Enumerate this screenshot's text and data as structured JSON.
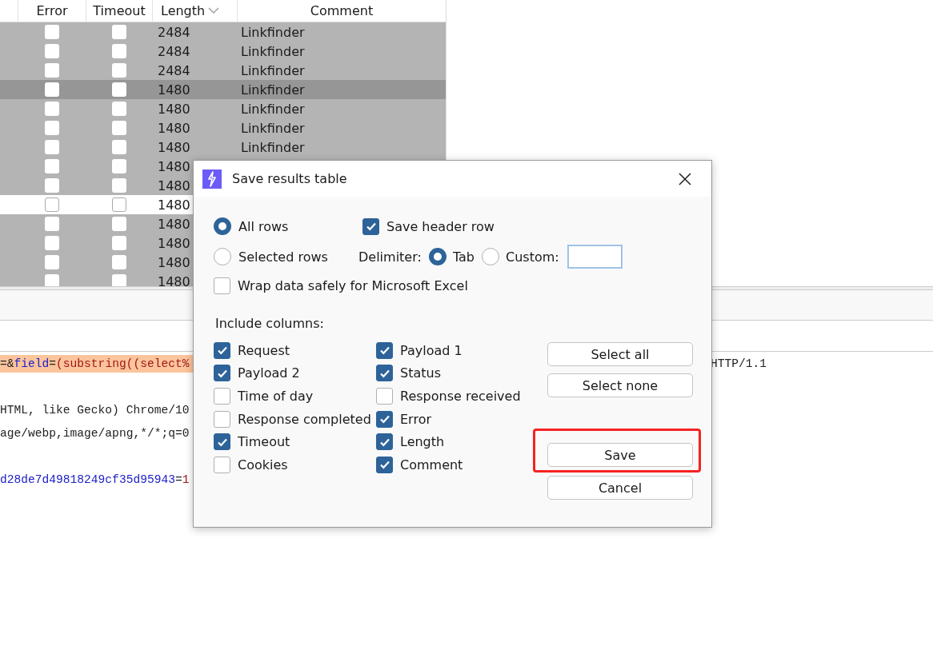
{
  "table": {
    "columns": [
      {
        "label": "Error",
        "sorted": false
      },
      {
        "label": "Timeout",
        "sorted": false
      },
      {
        "label": "Length",
        "sorted": true
      },
      {
        "label": "Comment",
        "sorted": false
      }
    ],
    "rows": [
      {
        "error": false,
        "timeout": false,
        "length": "2484",
        "comment": "Linkfinder",
        "selected": true,
        "focused": false
      },
      {
        "error": false,
        "timeout": false,
        "length": "2484",
        "comment": "Linkfinder",
        "selected": true,
        "focused": false
      },
      {
        "error": false,
        "timeout": false,
        "length": "2484",
        "comment": "Linkfinder",
        "selected": true,
        "focused": false
      },
      {
        "error": false,
        "timeout": false,
        "length": "1480",
        "comment": "Linkfinder",
        "selected": true,
        "focused": true
      },
      {
        "error": false,
        "timeout": false,
        "length": "1480",
        "comment": "Linkfinder",
        "selected": true,
        "focused": false
      },
      {
        "error": false,
        "timeout": false,
        "length": "1480",
        "comment": "Linkfinder",
        "selected": true,
        "focused": false
      },
      {
        "error": false,
        "timeout": false,
        "length": "1480",
        "comment": "Linkfinder",
        "selected": true,
        "focused": false
      },
      {
        "error": false,
        "timeout": false,
        "length": "1480",
        "selected": true,
        "focused": false
      },
      {
        "error": false,
        "timeout": false,
        "length": "1480",
        "selected": true,
        "focused": false
      },
      {
        "error": false,
        "timeout": false,
        "length": "1480",
        "selected": false,
        "focused": false
      },
      {
        "error": false,
        "timeout": false,
        "length": "1480",
        "selected": true,
        "focused": false
      },
      {
        "error": false,
        "timeout": false,
        "length": "1480",
        "selected": true,
        "focused": false
      },
      {
        "error": false,
        "timeout": false,
        "length": "1480",
        "selected": true,
        "focused": false
      },
      {
        "error": false,
        "timeout": false,
        "length": "1480",
        "selected": true,
        "focused": false
      }
    ]
  },
  "request_lines": [
    {
      "highlighted": true,
      "left": [
        {
          "kind": "plain",
          "text": "=&"
        },
        {
          "kind": "name",
          "text": "field"
        },
        {
          "kind": "plain",
          "text": "="
        },
        {
          "kind": "value",
          "text": "(substring((select%"
        }
      ],
      "right": [
        {
          "kind": "plain",
          "text": "HTTP/1.1"
        }
      ]
    },
    {
      "highlighted": false
    },
    {
      "highlighted": false,
      "left": [
        {
          "kind": "plain",
          "text": "HTML, like Gecko) Chrome/10"
        }
      ]
    },
    {
      "highlighted": false,
      "left": [
        {
          "kind": "plain",
          "text": "age/webp,image/apng,*/*;q=0"
        }
      ]
    },
    {
      "highlighted": false
    },
    {
      "highlighted": false,
      "left": [
        {
          "kind": "name",
          "text": "d28de7d49818249cf35d95943"
        },
        {
          "kind": "plain",
          "text": "="
        },
        {
          "kind": "value",
          "text": "1"
        }
      ]
    }
  ],
  "dialog": {
    "title": "Save results table",
    "row_scope": [
      {
        "label": "All rows",
        "selected": true
      },
      {
        "label": "Selected rows",
        "selected": false
      }
    ],
    "save_header_row": {
      "label": "Save header row",
      "checked": true
    },
    "delimiter": {
      "label": "Delimiter:",
      "options": [
        {
          "label": "Tab",
          "selected": true
        },
        {
          "label": "Custom:",
          "selected": false
        }
      ]
    },
    "wrap_excel": {
      "label": "Wrap data safely for Microsoft Excel",
      "checked": false
    },
    "include_columns": {
      "label": "Include columns:",
      "columns": [
        {
          "label": "Request",
          "checked": true
        },
        {
          "label": "Payload 2",
          "checked": true
        },
        {
          "label": "Time of day",
          "checked": false
        },
        {
          "label": "Response completed",
          "checked": false
        },
        {
          "label": "Timeout",
          "checked": true
        },
        {
          "label": "Cookies",
          "checked": false
        },
        {
          "label": "Payload 1",
          "checked": true
        },
        {
          "label": "Status",
          "checked": true
        },
        {
          "label": "Response received",
          "checked": false
        },
        {
          "label": "Error",
          "checked": true
        },
        {
          "label": "Length",
          "checked": true
        },
        {
          "label": "Comment",
          "checked": true
        }
      ]
    },
    "buttons": [
      {
        "label": "Select all",
        "kind": "top",
        "highlighted": false
      },
      {
        "label": "Select none",
        "kind": "top",
        "highlighted": false
      },
      {
        "label": "Save",
        "kind": "bottom",
        "highlighted": true
      },
      {
        "label": "Cancel",
        "kind": "bottom",
        "highlighted": false
      }
    ]
  }
}
